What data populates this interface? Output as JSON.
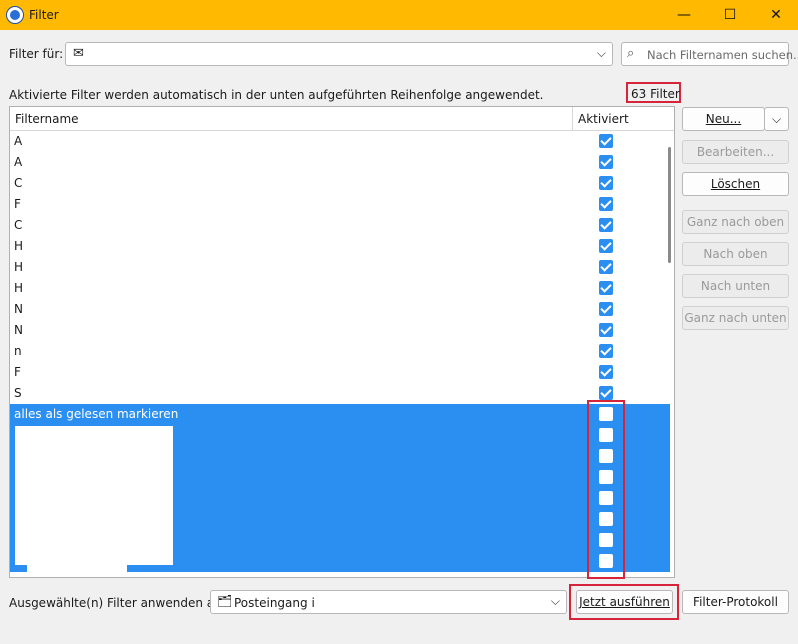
{
  "window": {
    "title": "Filter",
    "minimize": "—",
    "maximize": "☐",
    "close": "✕"
  },
  "filter_for": {
    "label": "Filter für:",
    "chevron": "⌵"
  },
  "search": {
    "placeholder": "Nach Filternamen suchen...",
    "icon": "search-icon"
  },
  "info_text": "Aktivierte Filter werden automatisch in der unten aufgeführten Reihenfolge angewendet.",
  "filter_count": "63 Filter",
  "columns": {
    "name": "Filtername",
    "active": "Aktiviert"
  },
  "rows": [
    {
      "name": "A",
      "enabled": true,
      "selected": false
    },
    {
      "name": "A",
      "enabled": true,
      "selected": false
    },
    {
      "name": "C",
      "enabled": true,
      "selected": false
    },
    {
      "name": "F",
      "enabled": true,
      "selected": false
    },
    {
      "name": "C",
      "enabled": true,
      "selected": false
    },
    {
      "name": "H",
      "enabled": true,
      "selected": false
    },
    {
      "name": "H",
      "enabled": true,
      "selected": false
    },
    {
      "name": "H",
      "enabled": true,
      "selected": false
    },
    {
      "name": "N",
      "enabled": true,
      "selected": false
    },
    {
      "name": "N",
      "enabled": true,
      "selected": false
    },
    {
      "name": "n",
      "enabled": true,
      "selected": false
    },
    {
      "name": "F",
      "enabled": true,
      "selected": false
    },
    {
      "name": "S",
      "enabled": true,
      "selected": false
    },
    {
      "name": "alles als gelesen markieren",
      "enabled": false,
      "selected": true
    },
    {
      "name": "",
      "enabled": false,
      "selected": true
    },
    {
      "name": "",
      "enabled": false,
      "selected": true
    },
    {
      "name": "",
      "enabled": false,
      "selected": true
    },
    {
      "name": "",
      "enabled": false,
      "selected": true
    },
    {
      "name": "",
      "enabled": false,
      "selected": true
    },
    {
      "name": "",
      "enabled": false,
      "selected": true
    },
    {
      "name": "",
      "enabled": false,
      "selected": true
    }
  ],
  "buttons": {
    "new": "Neu...",
    "new_dropdown": "⌵",
    "edit": "Bearbeiten...",
    "delete": "Löschen",
    "top": "Ganz nach oben",
    "up": "Nach oben",
    "down": "Nach unten",
    "bottom": "Ganz nach unten",
    "run_now": "Jetzt ausführen",
    "log": "Filter-Protokoll"
  },
  "apply_to": {
    "label": "Ausgewählte(n) Filter anwenden auf:",
    "folder": "Posteingang in",
    "chevron": "⌵"
  },
  "colors": {
    "titlebar": "#ffb900",
    "selection": "#2a8ff0",
    "checkbox": "#2a8ff0",
    "highlight": "#d6243a"
  }
}
